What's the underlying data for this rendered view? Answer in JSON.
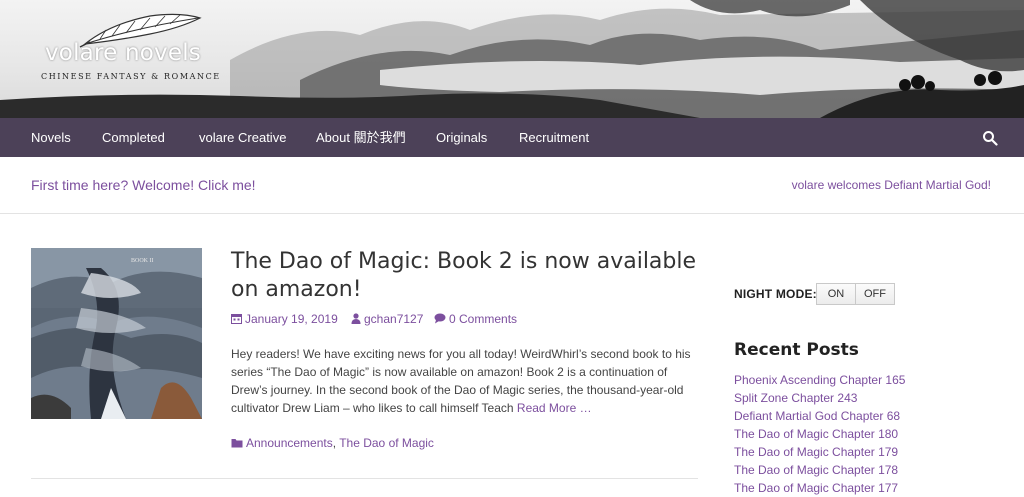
{
  "header": {
    "logo_title_part1": "volare",
    "logo_title_part2": " novels",
    "tagline": "CHINESE FANTASY & ROMANCE",
    "logo_icon": "feather-icon"
  },
  "nav": {
    "items": [
      {
        "label": "Novels"
      },
      {
        "label": "Completed"
      },
      {
        "label": "volare Creative"
      },
      {
        "label": "About 關於我們"
      },
      {
        "label": "Originals"
      },
      {
        "label": "Recruitment"
      }
    ],
    "search_icon": "search-icon"
  },
  "infobar": {
    "welcome": "First time here? Welcome! Click me!",
    "ticker": "volare welcomes Defiant Martial God!"
  },
  "post": {
    "title": "The Dao of Magic: Book 2 is now available on amazon!",
    "date": "January 19, 2019",
    "author": "gchan7127",
    "comments": "0 Comments",
    "excerpt": "Hey readers! We have exciting news for you all today! WeirdWhirl’s second book to his series “The Dao of Magic” is now available on amazon! Book 2 is a continuation of Drew’s journey. In the second book of the Dao of Magic series, the thousand-year-old cultivator Drew Liam – who likes to call himself Teach",
    "read_more": "Read More …",
    "categories": [
      "Announcements",
      "The Dao of Magic"
    ],
    "category_separator": ",",
    "thumbnail_text": "BOOK II"
  },
  "sidebar": {
    "night_mode_label": "NIGHT MODE:",
    "night_mode_on": "ON",
    "night_mode_off": "OFF",
    "recent_title": "Recent Posts",
    "recent_posts": [
      "Phoenix Ascending Chapter 165",
      "Split Zone Chapter 243",
      "Defiant Martial God Chapter 68",
      "The Dao of Magic Chapter 180",
      "The Dao of Magic Chapter 179",
      "The Dao of Magic Chapter 178",
      "The Dao of Magic Chapter 177"
    ]
  },
  "colors": {
    "nav_bg": "#4c4158",
    "link": "#7c4f9e"
  }
}
